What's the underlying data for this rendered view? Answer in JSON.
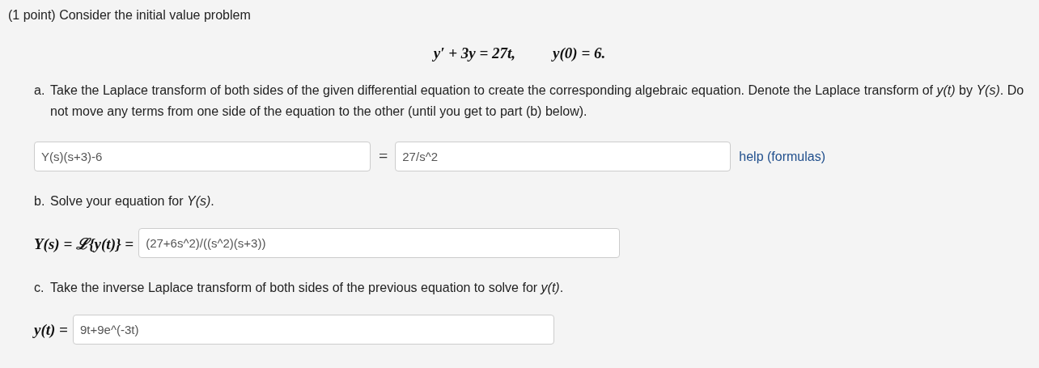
{
  "intro": "(1 point) Consider the initial value problem",
  "equation": {
    "left": "y′ + 3y = 27t,",
    "right": "y(0) = 6."
  },
  "parts": [
    {
      "kind": "equation",
      "label": "a.",
      "text": "Take the Laplace transform of both sides of the given differential equation to create the corresponding algebraic equation. Denote the Laplace transform of *y(t)* by *Y(s)*. Do not move any terms from one side of the equation to the other (until you get to part (b) below).",
      "left_value": "Y(s)(s+3)-6",
      "separator": "=",
      "right_value": "27/s^2",
      "link": "help (formulas)"
    },
    {
      "kind": "answer",
      "label": "b.",
      "text": "Solve your equation for *Y(s)*.",
      "prefix": "Y(s) = ℒ{y(t)} =",
      "value": "(27+6s^2)/((s^2)(s+3))"
    },
    {
      "kind": "answer",
      "label": "c.",
      "text": "Take the inverse Laplace transform of both sides of the previous equation to solve for *y(t)*.",
      "prefix": "y(t) =",
      "value": "9t+9e^(-3t)"
    }
  ]
}
